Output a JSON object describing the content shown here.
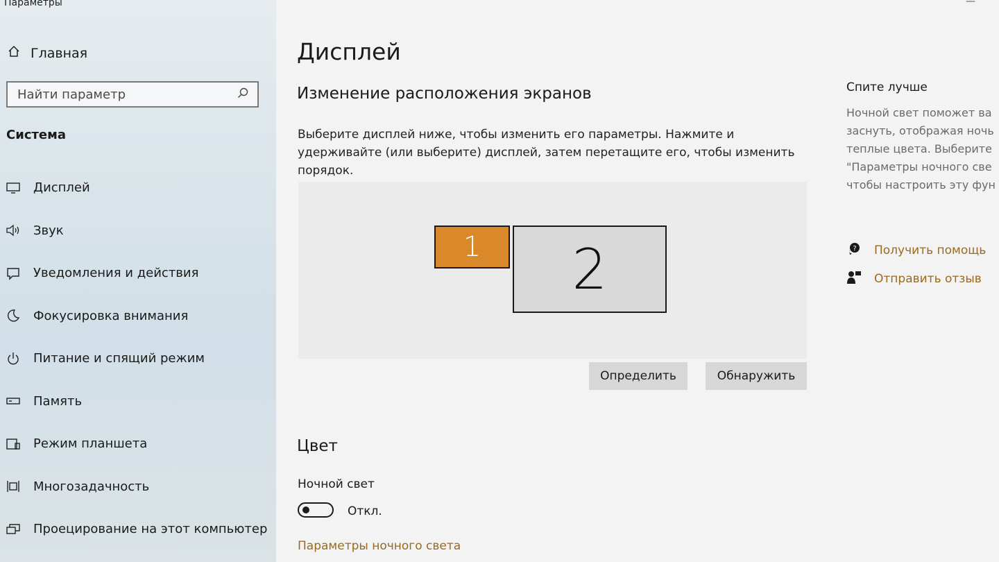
{
  "window": {
    "title": "Параметры"
  },
  "sidebar": {
    "home_label": "Главная",
    "search_placeholder": "Найти параметр",
    "section_title": "Система",
    "items": [
      {
        "label": "Дисплей",
        "icon": "monitor-icon"
      },
      {
        "label": "Звук",
        "icon": "speaker-icon"
      },
      {
        "label": "Уведомления и действия",
        "icon": "notification-icon"
      },
      {
        "label": "Фокусировка внимания",
        "icon": "moon-icon"
      },
      {
        "label": "Питание и спящий режим",
        "icon": "power-icon"
      },
      {
        "label": "Память",
        "icon": "storage-icon"
      },
      {
        "label": "Режим планшета",
        "icon": "tablet-icon"
      },
      {
        "label": "Многозадачность",
        "icon": "multitasking-icon"
      },
      {
        "label": "Проецирование на этот компьютер",
        "icon": "projection-icon"
      }
    ]
  },
  "main": {
    "title": "Дисплей",
    "subtitle": "Изменение расположения экранов",
    "description": "Выберите дисплей ниже, чтобы изменить его параметры. Нажмите и удерживайте (или выберите) дисплей, затем перетащите его, чтобы изменить порядок.",
    "monitors": [
      {
        "label": "1",
        "selected": true
      },
      {
        "label": "2",
        "selected": false
      }
    ],
    "identify_button": "Определить",
    "detect_button": "Обнаружить",
    "color_title": "Цвет",
    "night_light_label": "Ночной свет",
    "night_light_state": "Откл.",
    "night_light_on": false,
    "night_light_link": "Параметры ночного света"
  },
  "aside": {
    "title": "Спите лучше",
    "lines": [
      "Ночной свет поможет ва",
      "заснуть, отображая ночь",
      "теплые цвета. Выберите",
      "\"Параметры ночного све",
      "чтобы настроить эту фун"
    ],
    "help_link": "Получить помощь",
    "feedback_link": "Отправить отзыв"
  },
  "colors": {
    "accent": "#d9892a",
    "link": "#9a6a1e"
  }
}
